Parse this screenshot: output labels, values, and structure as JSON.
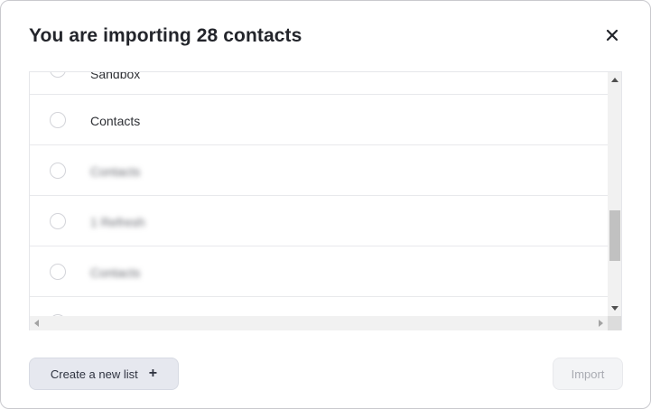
{
  "dialog": {
    "title": "You are importing 28 contacts",
    "close_icon": "close-icon"
  },
  "lists": {
    "items": [
      {
        "label": "Sandbox",
        "blurred": false,
        "partial": true,
        "selected": false
      },
      {
        "label": "Contacts",
        "blurred": false,
        "partial": false,
        "selected": false
      },
      {
        "label": "Contacts",
        "blurred": true,
        "partial": false,
        "selected": false
      },
      {
        "label": "1 Refresh",
        "blurred": true,
        "partial": false,
        "selected": false
      },
      {
        "label": "Contacts",
        "blurred": true,
        "partial": false,
        "selected": false
      },
      {
        "label": "",
        "blurred": false,
        "partial": true,
        "selected": false
      }
    ]
  },
  "footer": {
    "create_label": "Create a new list",
    "create_icon": "plus-icon",
    "import_label": "Import",
    "import_disabled": true
  },
  "colors": {
    "title": "#23252b",
    "create_bg": "#e6e8ef",
    "import_disabled_text": "#a9abb2"
  }
}
